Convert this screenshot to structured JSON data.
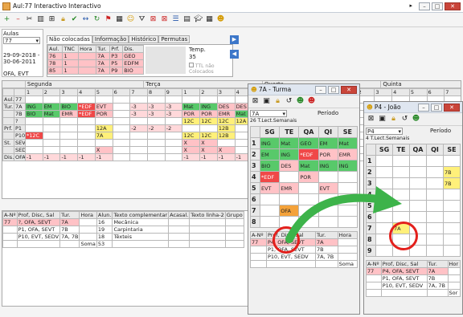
{
  "main": {
    "title": "Aul:77 Interactivo Interactivo",
    "tabs": [
      "Não colocadas",
      "Informação",
      "Histórico",
      "Permutas"
    ],
    "aulas_label": "Aulas",
    "aulas_value": "77",
    "dates": [
      "29-09-2018 -",
      "30-06-2011"
    ],
    "ofa": "OFA, EVT",
    "info_head": [
      "Aul.",
      "TNC",
      "Hora",
      "Tur.",
      "Prf.",
      "Dis."
    ],
    "info_rows": [
      [
        "76",
        "1",
        "",
        "7A",
        "P3",
        "GEO"
      ],
      [
        "78",
        "1",
        "",
        "7A",
        "P5",
        "EDFM"
      ],
      [
        "85",
        "1",
        "",
        "7A",
        "P9",
        "BIO"
      ]
    ],
    "temp_label": "Temp.",
    "temp_value": "35",
    "ttl_label": "TTL não Colocados",
    "days": [
      "Segunda",
      "Terça",
      "Quarta",
      "Quinta"
    ],
    "periods": [
      "1",
      "2",
      "3",
      "4",
      "5",
      "6",
      "7",
      "8",
      "9"
    ],
    "row_labels": [
      "Aul.",
      "Tur.",
      "",
      "",
      "Prf.",
      "",
      "",
      "St.",
      "",
      "Dis."
    ],
    "rows": [
      {
        "h": "Aul.",
        "c": [
          "77",
          "",
          "",
          "",
          "",
          "",
          "",
          "",
          "",
          "",
          "",
          "",
          "",
          "",
          "",
          "",
          "",
          "",
          "",
          "",
          "",
          "",
          "",
          "",
          ""
        ]
      },
      {
        "h": "Tur.",
        "c": [
          "7A",
          "ING",
          "EM",
          "BIO",
          "*EDF",
          "EVT",
          "",
          "-3",
          "-3",
          "-3",
          "Mat",
          "ING",
          "DES",
          "DES",
          "EMR",
          "",
          "OFA",
          "OFA",
          "",
          "",
          "",
          "",
          "",
          "",
          ""
        ]
      },
      {
        "h": "",
        "c": [
          "7B",
          "BIO",
          "Mat",
          "EMR",
          "*EDF",
          "POR",
          "",
          "-3",
          "-3",
          "-3",
          "POR",
          "POR",
          "EMR",
          "Mat",
          "",
          "",
          "OFA",
          "OFA",
          "",
          "",
          "",
          "",
          "",
          "",
          ""
        ]
      },
      {
        "h": "",
        "c": [
          "?",
          "",
          "",
          "",
          "",
          "",
          "",
          "",
          "",
          "",
          "12C",
          "12C",
          "12C",
          "12A",
          "12C",
          "",
          "7A",
          "7A",
          "",
          "",
          "",
          "",
          "",
          "",
          ""
        ]
      },
      {
        "h": "Prf.",
        "c": [
          "P1",
          "",
          "",
          "",
          "",
          "12A",
          "",
          "-2",
          "-2",
          "-2",
          "",
          "",
          "12B",
          "",
          "",
          "",
          "7B",
          "7B",
          "",
          "",
          "",
          "",
          "",
          "",
          ""
        ]
      },
      {
        "h": "",
        "c": [
          "P10",
          "*12C",
          "",
          "",
          "",
          "7A",
          "",
          "",
          "",
          "",
          "12C",
          "12C",
          "12B",
          "",
          "",
          "",
          "7A",
          "7A",
          "",
          "",
          "",
          "",
          "",
          "",
          ""
        ]
      },
      {
        "h": "St.",
        "c": [
          "SEVT",
          "",
          "",
          "",
          "",
          "",
          "",
          "",
          "",
          "",
          "X",
          "X",
          "",
          "",
          "",
          "",
          "O",
          "O",
          "",
          "",
          "",
          "",
          "",
          "",
          ""
        ]
      },
      {
        "h": "",
        "c": [
          "SEDV",
          "",
          "",
          "",
          "",
          "X",
          "",
          "",
          "",
          "",
          "X",
          "X",
          "X",
          "",
          "",
          "",
          "O",
          "O",
          "",
          "",
          "",
          "",
          "",
          "",
          ""
        ]
      },
      {
        "h": "Dis.",
        "c": [
          "OFA",
          "-1",
          "-1",
          "-1",
          "-1",
          "-1",
          "",
          "",
          "",
          "",
          "-1",
          "-1",
          "-1",
          "-1",
          "-1",
          "",
          "-1",
          "-1",
          "",
          "",
          "",
          "",
          "",
          "",
          ""
        ]
      }
    ],
    "bottom_head": [
      "A-Nº",
      "Prof, Disc, Sal",
      "Tur.",
      "Hora",
      "Alun.",
      "Texto complementar",
      "Acasal.",
      "Texto linha-2",
      "Grupo"
    ],
    "bottom_rows": [
      [
        "77",
        "?, OFA, SEVT",
        "7A",
        "",
        "16",
        "Mecânica"
      ],
      [
        "",
        "P1, OFA, SEVT",
        "7B",
        "",
        "19",
        "Carpintaria"
      ],
      [
        "",
        "P10, EVT, SEDV",
        "7A, 7B",
        "",
        "18",
        "Têxteis"
      ],
      [
        "",
        "",
        "",
        "Soma",
        "53",
        ""
      ]
    ]
  },
  "turma": {
    "title": "7A - Turma",
    "sel": "7A",
    "periodo_label": "Período",
    "lect": "26 T.Lect.Semanais",
    "cols": [
      "SG",
      "TE",
      "QA",
      "QI",
      "SE"
    ],
    "rows": [
      [
        "1",
        "ING",
        "Mat",
        "GEO",
        "EM",
        "Mat"
      ],
      [
        "2",
        "EM",
        "ING",
        "*EDF",
        "POR",
        "EMR"
      ],
      [
        "3",
        "BIO",
        "DES",
        "Mat",
        "ING",
        "ING"
      ],
      [
        "4",
        "*EDF",
        "",
        "POR",
        "",
        ""
      ],
      [
        "5",
        "EVT",
        "EMR",
        "",
        "EVT",
        ""
      ],
      [
        "6",
        "",
        "",
        "",
        "",
        ""
      ],
      [
        "7",
        "",
        "OFA",
        "",
        "",
        ""
      ],
      [
        "8",
        "",
        "",
        "",
        "",
        ""
      ]
    ],
    "bottom_head": [
      "A-Nº",
      "Prof, Disc, Sal",
      "Tur.",
      "Hora"
    ],
    "bottom_rows": [
      [
        "77",
        "P4, OFA, SEVT",
        "7A",
        ""
      ],
      [
        "",
        "P1, OFA, SEVT",
        "7B",
        ""
      ],
      [
        "",
        "P10, EVT, SEDV",
        "7A, 7B",
        ""
      ],
      [
        "",
        "",
        "",
        "Soma"
      ]
    ]
  },
  "prof": {
    "title": "P4 - João",
    "sel": "P4",
    "periodo_label": "Período",
    "lect": "4 T.Lect.Semanais",
    "cols": [
      "SG",
      "TE",
      "QA",
      "QI",
      "SE"
    ],
    "rows": [
      [
        "1",
        "",
        "",
        "",
        "",
        ""
      ],
      [
        "2",
        "",
        "",
        "",
        "",
        "7B"
      ],
      [
        "3",
        "",
        "",
        "",
        "",
        "7B"
      ],
      [
        "4",
        "",
        "",
        "",
        "",
        ""
      ],
      [
        "5",
        "",
        "",
        "",
        "",
        ""
      ],
      [
        "6",
        "",
        "",
        "",
        "",
        ""
      ],
      [
        "7",
        "",
        "7A",
        "",
        "",
        ""
      ],
      [
        "8",
        "",
        "",
        "",
        "",
        ""
      ],
      [
        "9",
        "",
        "",
        "",
        "",
        ""
      ]
    ],
    "bottom_head": [
      "A-Nº",
      "Prof, Disc, Sal",
      "Tur.",
      "Hor"
    ],
    "bottom_rows": [
      [
        "77",
        "P4, OFA, SEVT",
        "7A",
        ""
      ],
      [
        "",
        "P1, OFA, SEVT",
        "7B",
        ""
      ],
      [
        "",
        "P10, EVT, SEDV",
        "7A, 7B",
        ""
      ],
      [
        "",
        "",
        "",
        "Sor"
      ]
    ]
  }
}
